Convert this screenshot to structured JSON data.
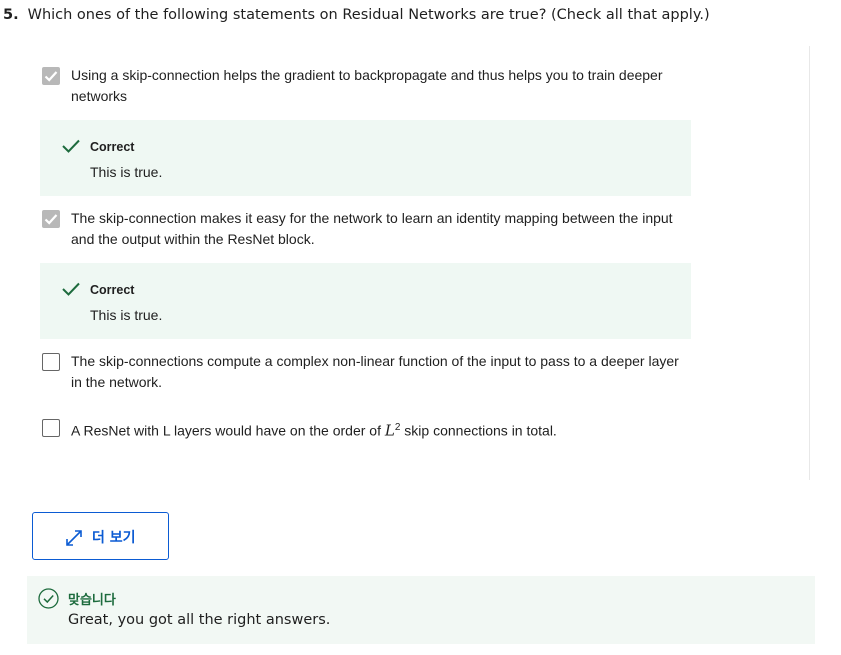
{
  "question": {
    "number": "5.",
    "text": "Which ones of the following statements on Residual Networks are true? (Check all that apply.)"
  },
  "options": [
    {
      "text": "Using a skip-connection helps the gradient to backpropagate and thus helps you to train deeper networks",
      "checked": true
    },
    {
      "text": "The skip-connection makes it easy for the network to learn an identity mapping between the input and the output within the ResNet block.",
      "checked": true
    },
    {
      "text": "The skip-connections compute a complex non-linear function of the input to pass to a deeper layer in the network.",
      "checked": false
    },
    {
      "text_before": "A ResNet with L layers would have on the order of ",
      "math_var": "L",
      "math_exp": "2",
      "text_after": " skip connections in total.",
      "checked": false
    }
  ],
  "feedback": [
    {
      "title": "Correct",
      "text": "This is true."
    },
    {
      "title": "Correct",
      "text": "This is true."
    }
  ],
  "more_button": {
    "label": "더 보기",
    "icon": "expand-icon"
  },
  "result": {
    "title": "맞습니다",
    "text": "Great, you got all the right answers.",
    "icon": "check-circle-icon"
  },
  "colors": {
    "correct_green": "#1d6b3d",
    "feedback_bg": "#eff8f3",
    "link_blue": "#0b5bd3",
    "checkbox_checked": "#b8b8b8"
  }
}
